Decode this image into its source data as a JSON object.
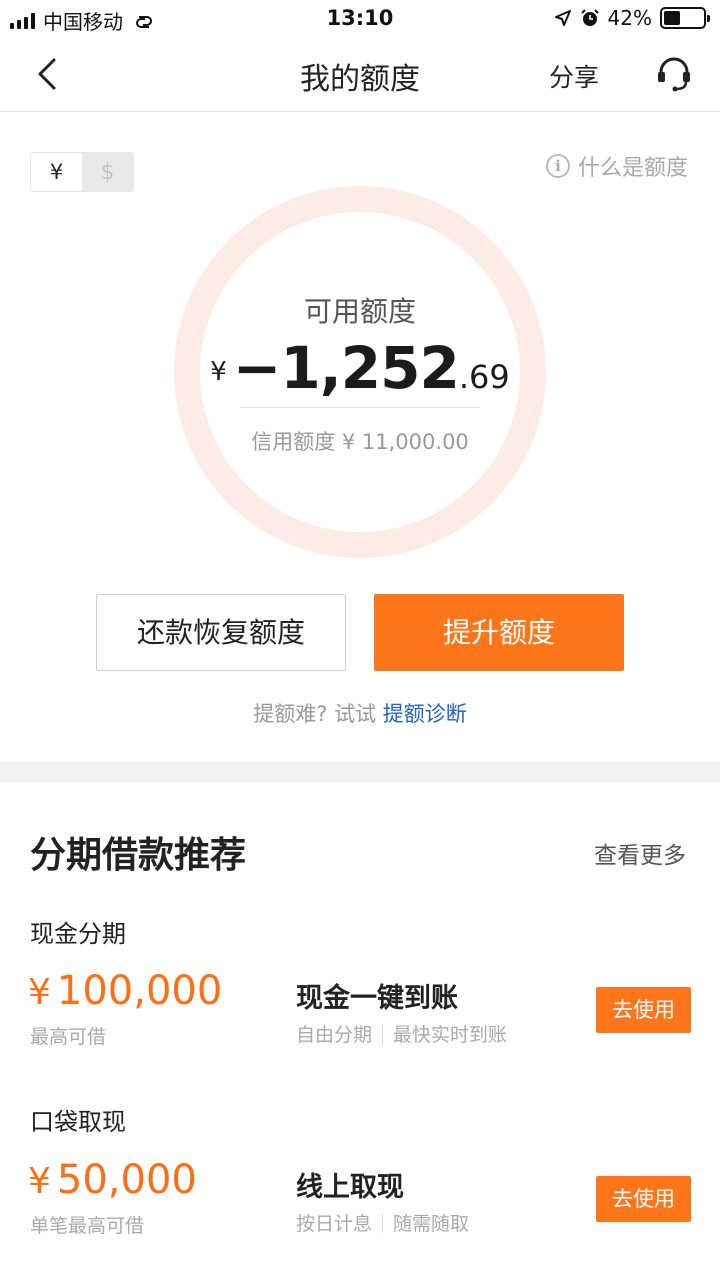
{
  "status_bar": {
    "carrier": "中国移动",
    "time": "13:10",
    "battery_percent_text": "42%",
    "battery_level": 0.42
  },
  "nav": {
    "title": "我的额度",
    "share_label": "分享"
  },
  "credit": {
    "currency_options": [
      "¥",
      "$"
    ],
    "what_is_label": "什么是额度",
    "available_label": "可用额度",
    "currency_symbol": "¥",
    "amount_main": "−1,252",
    "amount_decimal": ".69",
    "credit_limit_text": "信用额度 ¥ 11,000.00"
  },
  "actions": {
    "repay_label": "还款恢复额度",
    "raise_label": "提升额度",
    "tip_text": "提额难? 试试 ",
    "tip_link": "提额诊断"
  },
  "recommend": {
    "title": "分期借款推荐",
    "view_more": "查看更多",
    "items": [
      {
        "category": "现金分期",
        "currency": "¥",
        "amount": "100,000",
        "sub_label": "最高可借",
        "product_name": "现金一键到账",
        "tags": [
          "自由分期",
          "最快实时到账"
        ],
        "button": "去使用"
      },
      {
        "category": "口袋取现",
        "currency": "¥",
        "amount": "50,000",
        "sub_label": "单笔最高可借",
        "product_name": "线上取现",
        "tags": [
          "按日计息",
          "随需随取"
        ],
        "button": "去使用"
      }
    ]
  },
  "colors": {
    "accent": "#ff7519",
    "link": "#1f64c6",
    "ring": "#fdece6"
  },
  "icons": [
    "signal-icon",
    "link-icon",
    "location-arrow-icon",
    "alarm-icon",
    "battery-icon",
    "back-icon",
    "customer-service-icon",
    "info-icon"
  ]
}
